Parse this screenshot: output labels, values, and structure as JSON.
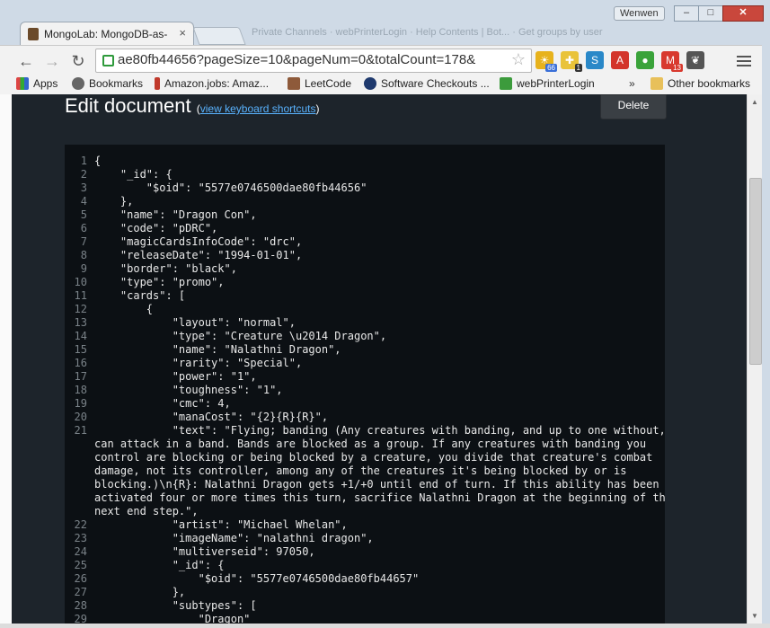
{
  "window": {
    "user": "Wenwen",
    "min_label": "–",
    "max_label": "□",
    "close_label": "✕"
  },
  "tab": {
    "title": "MongoLab: MongoDB-as-",
    "close": "×"
  },
  "background_tabs": "Private Channels · webPrinterLogin · Help Contents | Bot... · Get groups by user",
  "toolbar": {
    "back": "←",
    "forward": "→",
    "reload": "↻",
    "url": "ae80fb44656?pageSize=10&pageNum=0&totalCount=178&",
    "star": "☆",
    "extensions": [
      {
        "name": "sun-extension-icon",
        "glyph": "☀",
        "color": "#e7b21c",
        "badge": "66",
        "badge_color": "#3a6fd8"
      },
      {
        "name": "puzzle-extension-icon",
        "glyph": "✚",
        "color": "#e9c33a",
        "badge": "1",
        "badge_color": "#333333"
      },
      {
        "name": "s-extension-icon",
        "glyph": "S",
        "color": "#2a88c8",
        "badge": "",
        "badge_color": ""
      },
      {
        "name": "pdf-extension-icon",
        "glyph": "A",
        "color": "#d3352b",
        "badge": "",
        "badge_color": ""
      },
      {
        "name": "chat-extension-icon",
        "glyph": "●",
        "color": "#3aa33a",
        "badge": "",
        "badge_color": ""
      },
      {
        "name": "gmail-extension-icon",
        "glyph": "M",
        "color": "#d8392e",
        "badge": "13",
        "badge_color": "#d8392e"
      },
      {
        "name": "evernote-extension-icon",
        "glyph": "❦",
        "color": "#555555",
        "badge": "",
        "badge_color": ""
      }
    ]
  },
  "bookmarks": {
    "items": [
      {
        "label": "Apps",
        "icon_color": "#d44"
      },
      {
        "label": "Bookmarks",
        "icon_color": "#666"
      },
      {
        "label": "Amazon.jobs: Amaz...",
        "icon_color": "#c0392b"
      },
      {
        "label": "LeetCode",
        "icon_color": "#8e5a3a"
      },
      {
        "label": "Software Checkouts ...",
        "icon_color": "#1f3a6e"
      },
      {
        "label": "webPrinterLogin",
        "icon_color": "#3c9b3c"
      }
    ],
    "more": "»",
    "other": "Other bookmarks"
  },
  "page": {
    "title": "Edit document",
    "shortcuts_link": "view keyboard shortcuts",
    "delete_label": "Delete"
  },
  "editor": {
    "lines": [
      {
        "n": "1",
        "t": "{"
      },
      {
        "n": "2",
        "t": "    \"_id\": {"
      },
      {
        "n": "3",
        "t": "        \"$oid\": \"5577e0746500dae80fb44656\""
      },
      {
        "n": "4",
        "t": "    },"
      },
      {
        "n": "5",
        "t": "    \"name\": \"Dragon Con\","
      },
      {
        "n": "6",
        "t": "    \"code\": \"pDRC\","
      },
      {
        "n": "7",
        "t": "    \"magicCardsInfoCode\": \"drc\","
      },
      {
        "n": "8",
        "t": "    \"releaseDate\": \"1994-01-01\","
      },
      {
        "n": "9",
        "t": "    \"border\": \"black\","
      },
      {
        "n": "10",
        "t": "    \"type\": \"promo\","
      },
      {
        "n": "11",
        "t": "    \"cards\": ["
      },
      {
        "n": "12",
        "t": "        {"
      },
      {
        "n": "13",
        "t": "            \"layout\": \"normal\","
      },
      {
        "n": "14",
        "t": "            \"type\": \"Creature \\u2014 Dragon\","
      },
      {
        "n": "15",
        "t": "            \"name\": \"Nalathni Dragon\","
      },
      {
        "n": "16",
        "t": "            \"rarity\": \"Special\","
      },
      {
        "n": "17",
        "t": "            \"power\": \"1\","
      },
      {
        "n": "18",
        "t": "            \"toughness\": \"1\","
      },
      {
        "n": "19",
        "t": "            \"cmc\": 4,"
      },
      {
        "n": "20",
        "t": "            \"manaCost\": \"{2}{R}{R}\","
      },
      {
        "n": "21",
        "t": "            \"text\": \"Flying; banding (Any creatures with banding, and up to one without,"
      },
      {
        "n": "",
        "t": "can attack in a band. Bands are blocked as a group. If any creatures with banding you"
      },
      {
        "n": "",
        "t": "control are blocking or being blocked by a creature, you divide that creature's combat"
      },
      {
        "n": "",
        "t": "damage, not its controller, among any of the creatures it's being blocked by or is"
      },
      {
        "n": "",
        "t": "blocking.)\\n{R}: Nalathni Dragon gets +1/+0 until end of turn. If this ability has been"
      },
      {
        "n": "",
        "t": "activated four or more times this turn, sacrifice Nalathni Dragon at the beginning of the"
      },
      {
        "n": "",
        "t": "next end step.\","
      },
      {
        "n": "22",
        "t": "            \"artist\": \"Michael Whelan\","
      },
      {
        "n": "23",
        "t": "            \"imageName\": \"nalathni dragon\","
      },
      {
        "n": "24",
        "t": "            \"multiverseid\": 97050,"
      },
      {
        "n": "25",
        "t": "            \"_id\": {"
      },
      {
        "n": "26",
        "t": "                \"$oid\": \"5577e0746500dae80fb44657\""
      },
      {
        "n": "27",
        "t": "            },"
      },
      {
        "n": "28",
        "t": "            \"subtypes\": ["
      },
      {
        "n": "29",
        "t": "                \"Dragon\""
      }
    ]
  }
}
